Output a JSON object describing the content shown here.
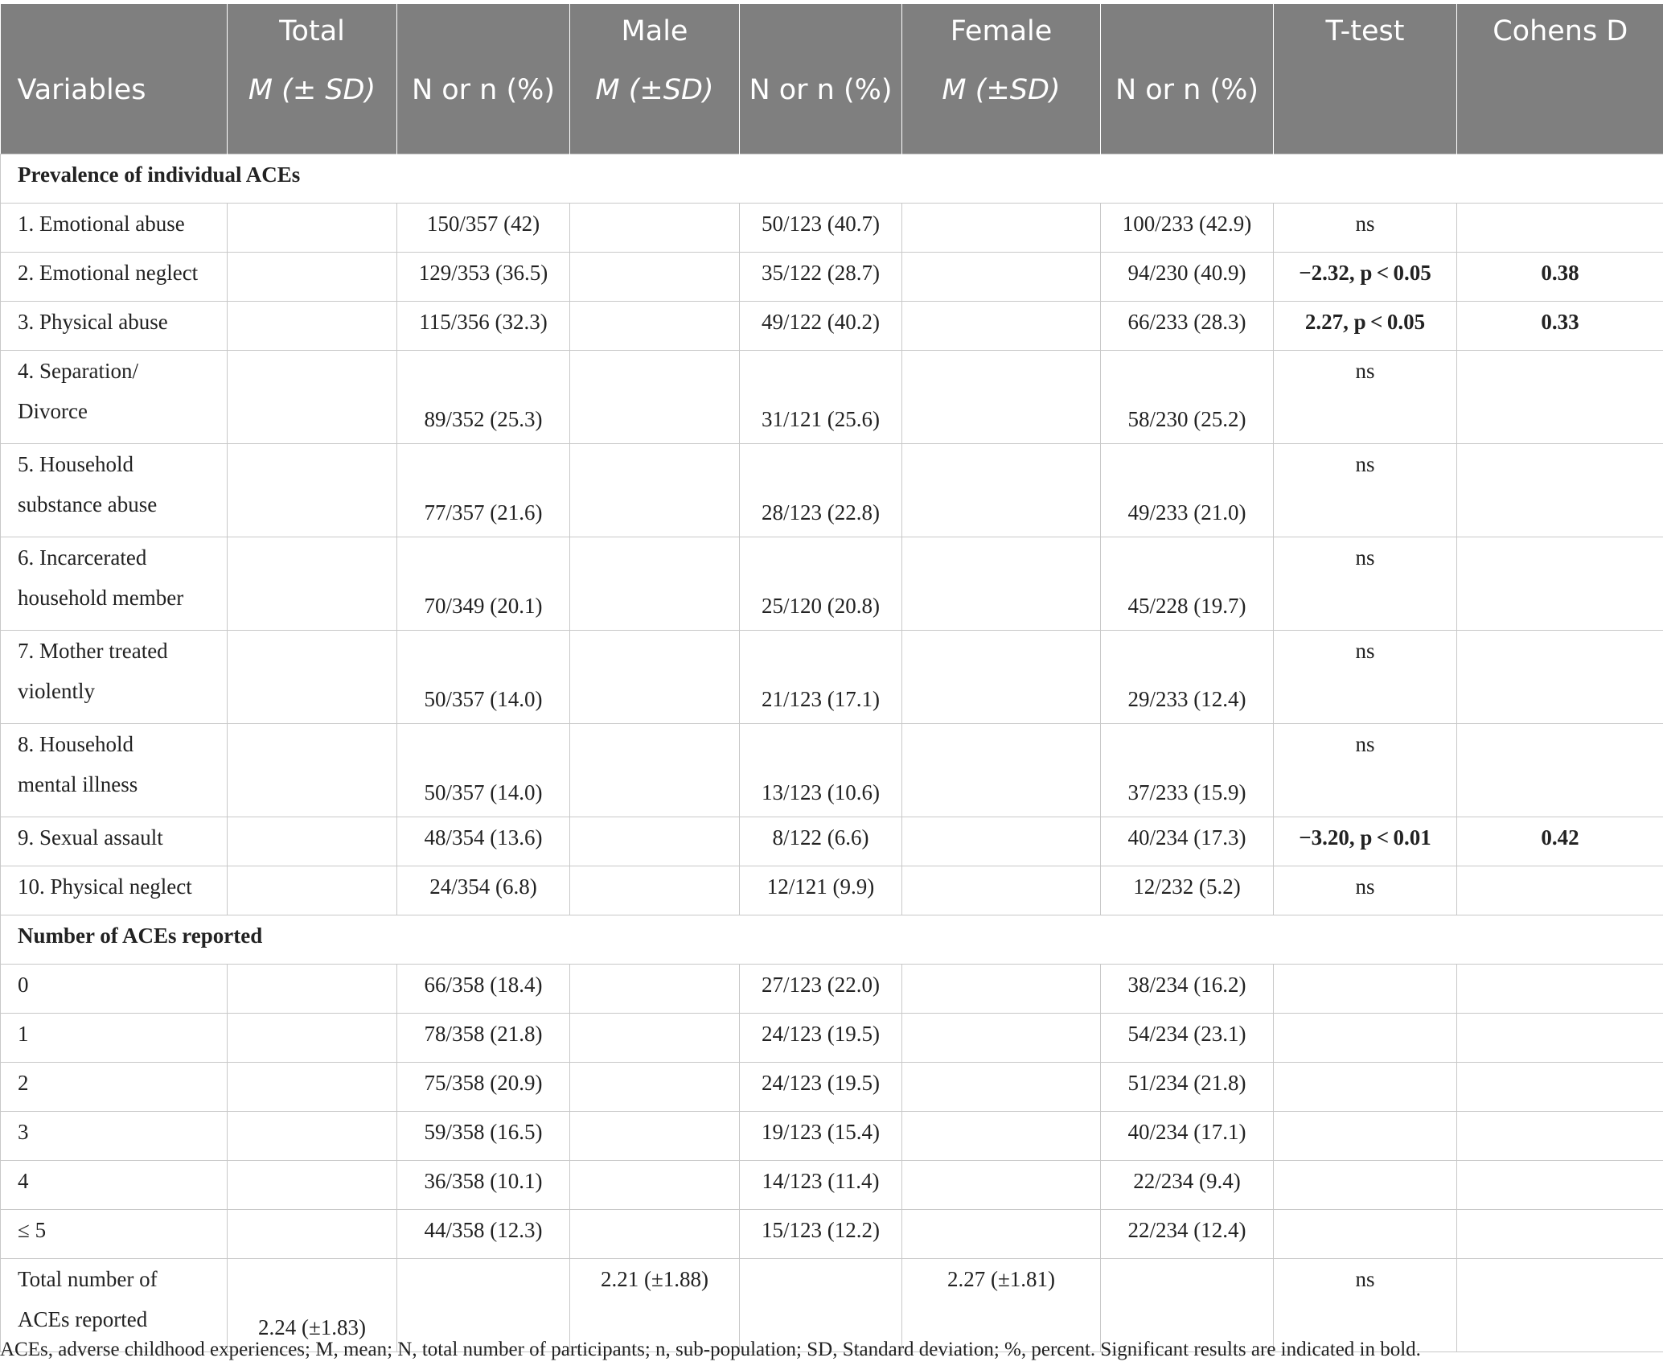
{
  "header": {
    "row1": [
      "",
      "Total",
      "",
      "Male",
      "",
      "Female",
      "",
      "T-test",
      "Cohens D"
    ],
    "row2": [
      "Variables",
      "M (± SD)",
      "N or n (%)",
      "M (±SD)",
      "N or n (%)",
      "M (±SD)",
      "N or n (%)",
      "",
      ""
    ]
  },
  "section_prevalence": "Prevalence of individual ACEs",
  "prevalence_rows": [
    {
      "label": "1. Emotional abuse",
      "total_n": "150/357 (42)",
      "male_n": "50/123 (40.7)",
      "female_n": "100/233 (42.9)",
      "ttest": "ns",
      "d": ""
    },
    {
      "label": "2. Emotional neglect",
      "total_n": "129/353 (36.5)",
      "male_n": "35/122 (28.7)",
      "female_n": "94/230 (40.9)",
      "ttest": "−2.32, p < 0.05",
      "d": "0.38"
    },
    {
      "label": "3. Physical abuse",
      "total_n": "115/356 (32.3)",
      "male_n": "49/122 (40.2)",
      "female_n": "66/233 (28.3)",
      "ttest": "2.27, p < 0.05",
      "d": "0.33"
    },
    {
      "label_l1": "4. Separation/",
      "label_l2": "Divorce",
      "total_n": "89/352 (25.3)",
      "male_n": "31/121 (25.6)",
      "female_n": "58/230 (25.2)",
      "ttest": "ns"
    },
    {
      "label_l1": "5. Household",
      "label_l2": "substance abuse",
      "total_n": "77/357 (21.6)",
      "male_n": "28/123 (22.8)",
      "female_n": "49/233 (21.0)",
      "ttest": "ns"
    },
    {
      "label_l1": "6. Incarcerated",
      "label_l2": "household member",
      "total_n": "70/349 (20.1)",
      "male_n": "25/120 (20.8)",
      "female_n": "45/228 (19.7)",
      "ttest": "ns"
    },
    {
      "label_l1": "7. Mother treated",
      "label_l2": "violently",
      "total_n": "50/357 (14.0)",
      "male_n": "21/123 (17.1)",
      "female_n": "29/233 (12.4)",
      "ttest": "ns"
    },
    {
      "label_l1": "8. Household",
      "label_l2": "mental illness",
      "total_n": "50/357 (14.0)",
      "male_n": "13/123 (10.6)",
      "female_n": "37/233 (15.9)",
      "ttest": "ns"
    },
    {
      "label": "9. Sexual assault",
      "total_n": "48/354 (13.6)",
      "male_n": "8/122 (6.6)",
      "female_n": "40/234 (17.3)",
      "ttest": "−3.20, p < 0.01",
      "d": "0.42"
    },
    {
      "label": "10. Physical neglect",
      "total_n": "24/354 (6.8)",
      "male_n": "12/121 (9.9)",
      "female_n": "12/232 (5.2)",
      "ttest": "ns",
      "d": ""
    }
  ],
  "section_number": "Number of ACEs reported",
  "number_rows": [
    {
      "label": "0",
      "total_n": "66/358 (18.4)",
      "male_n": "27/123 (22.0)",
      "female_n": "38/234 (16.2)"
    },
    {
      "label": "1",
      "total_n": "78/358 (21.8)",
      "male_n": "24/123 (19.5)",
      "female_n": "54/234 (23.1)"
    },
    {
      "label": "2",
      "total_n": "75/358 (20.9)",
      "male_n": "24/123 (19.5)",
      "female_n": "51/234 (21.8)"
    },
    {
      "label": "3",
      "total_n": "59/358 (16.5)",
      "male_n": "19/123 (15.4)",
      "female_n": "40/234 (17.1)"
    },
    {
      "label": "4",
      "total_n": "36/358 (10.1)",
      "male_n": "14/123 (11.4)",
      "female_n": "22/234 (9.4)"
    },
    {
      "label": "≤ 5",
      "total_n": "44/358 (12.3)",
      "male_n": "15/123 (12.2)",
      "female_n": "22/234 (12.4)"
    }
  ],
  "total_row": {
    "label_l1": "Total number of",
    "label_l2": "ACEs reported",
    "total_m": "2.24 (±1.83)",
    "male_m": "2.21 (±1.88)",
    "female_m": "2.27 (±1.81)",
    "ttest": "ns"
  },
  "footnote": "ACEs, adverse childhood experiences; M, mean; N, total number of participants; n, sub-population; SD, Standard deviation; %, percent. Significant results are indicated in bold."
}
